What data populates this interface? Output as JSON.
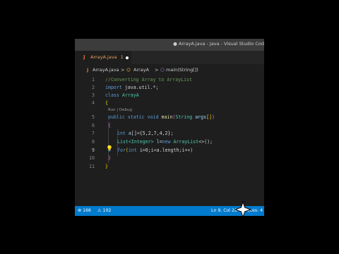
{
  "window": {
    "title": "● ArrayA.java - Java - Visual Studio Cod"
  },
  "tab": {
    "icon_letter": "J",
    "label": "ArrayA.java",
    "suffix": "1"
  },
  "breadcrumb": {
    "file_icon": "J",
    "file": "ArrayA.java",
    "sep": ">",
    "class_icon": "⌬",
    "class": "ArrayA",
    "method_icon": "⬡",
    "method": "main(String[])"
  },
  "codelens": "Run | Debug",
  "lines": [
    "1",
    "2",
    "3",
    "4",
    "5",
    "6",
    "7",
    "8",
    "9",
    "10",
    "11"
  ],
  "code": {
    "l1": "//Converting Array to ArrayList",
    "l2_kw": "import",
    "l2_rest": " java.util.*;",
    "l3_kw": "class",
    "l3_name": "ArrayA",
    "l4": "{",
    "l5_kw1": "public",
    "l5_kw2": "static",
    "l5_kw3": "void",
    "l5_fn": "main",
    "l5_open": "(",
    "l5_ty": "String",
    "l5_pm": "args",
    "l5_arr": "[]",
    "l5_close": ")",
    "l6": "{",
    "l7_kw": "int",
    "l7_pm": "a",
    "l7_rest": "[]={5,2,7,4,2};",
    "l8_ty": "List",
    "l8_gen": "<Integer>",
    "l8_pm": "l",
    "l8_eq": "=",
    "l8_kw": "new",
    "l8_ty2": "ArrayList",
    "l8_rest": "<>();",
    "l9_kw": "for",
    "l9_open": "(",
    "l9_kw2": "int",
    "l9_rest": "i=0;i<a.length;i++)",
    "l10": "}",
    "l11": "}"
  },
  "status": {
    "errors": "⊗ 166",
    "warnings": "⚠ 102",
    "position": "Ln 9, Col 28",
    "spaces": "Spaces: 4"
  },
  "colors": {
    "statusbar": "#007acc",
    "editor_bg": "#1e1e1e",
    "keyword": "#569cd6",
    "type": "#4ec9b0",
    "comment": "#6a9955"
  }
}
